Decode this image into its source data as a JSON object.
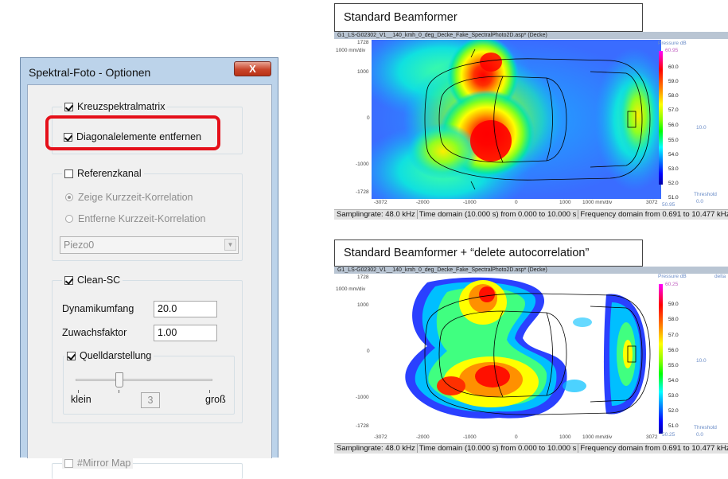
{
  "dialog": {
    "title": "Spektral-Foto - Optionen",
    "close_glyph": "X",
    "kreuz": {
      "label": "Kreuzspektralmatrix",
      "checked": true
    },
    "diag": {
      "label": "Diagonalelemente entfernen",
      "checked": true
    },
    "ref": {
      "label": "Referenzkanal",
      "checked": false
    },
    "radio_kurz": "Zeige Kurzzeit-Korrelation",
    "radio_entf": "Entferne Kurzzeit-Korrelation",
    "combo_value": "Piezo0",
    "clean": {
      "label": "Clean-SC",
      "checked": true
    },
    "dynamik_label": "Dynamikumfang",
    "dynamik_value": "20.0",
    "zuwachs_label": "Zuwachsfaktor",
    "zuwachs_value": "1.00",
    "quell": {
      "label": "Quelldarstellung",
      "checked": true
    },
    "slider_value": "3",
    "klein_label": "klein",
    "gross_label": "groß",
    "mirror": {
      "label": "#Mirror Map",
      "checked": false
    }
  },
  "top": {
    "callout": "Standard Beamformer",
    "window_title": "G1_LS-G02302_V1__140_kmh_0_deg_Decke_Fake_SpectralPhoto2D.asp* (Decke)",
    "pressure_label": "Pressure dB",
    "cb_max": "60.95",
    "cb_min": "50.95",
    "cb_ticks": [
      "60.0",
      "59.0",
      "58.0",
      "57.0",
      "56.0",
      "55.0",
      "54.0",
      "53.0",
      "52.0",
      "51.0"
    ],
    "y_ticks": [
      "1728",
      "1000",
      "0",
      "-1000",
      "-1728"
    ],
    "x_ticks": [
      "-3072",
      "-2000",
      "-1000",
      "0",
      "1000",
      "3072"
    ],
    "y_unit": "1000 mm/div",
    "x_unit": "1000 mm/div",
    "side_value": "10.0",
    "threshold_label": "Threshold",
    "threshold_value": "0.0",
    "status_items": [
      "Samplingrate: 48.0 kHz",
      "Time domain (10.000 s) from 0.000 to 10.000 s",
      "Frequency domain from 0.691 to 10.477 kHz"
    ]
  },
  "bottom": {
    "callout": "Standard Beamformer + “delete autocorrelation”",
    "window_title": "G1_LS-G02302_V1__140_kmh_0_deg_Decke_Fake_SpectralPhoto2D.asp* (Decke)",
    "pressure_label": "Pressure dB",
    "delta_label": "delta",
    "cb_max": "60.25",
    "cb_min": "50.25",
    "cb_ticks": [
      "59.0",
      "58.0",
      "57.0",
      "56.0",
      "55.0",
      "54.0",
      "53.0",
      "52.0",
      "51.0"
    ],
    "y_ticks": [
      "1728",
      "1000",
      "0",
      "-1000",
      "-1728"
    ],
    "x_ticks": [
      "-3072",
      "-2000",
      "-1000",
      "0",
      "1000",
      "3072"
    ],
    "y_unit": "1000 mm/div",
    "x_unit": "1000 mm/div",
    "side_value": "10.0",
    "threshold_label": "Threshold",
    "threshold_value": "0.0",
    "status_items": [
      "Samplingrate: 48.0 kHz",
      "Time domain (10.000 s) from 0.000 to 10.000 s",
      "Frequency domain from 0.691 to 10.477 kHz"
    ]
  }
}
